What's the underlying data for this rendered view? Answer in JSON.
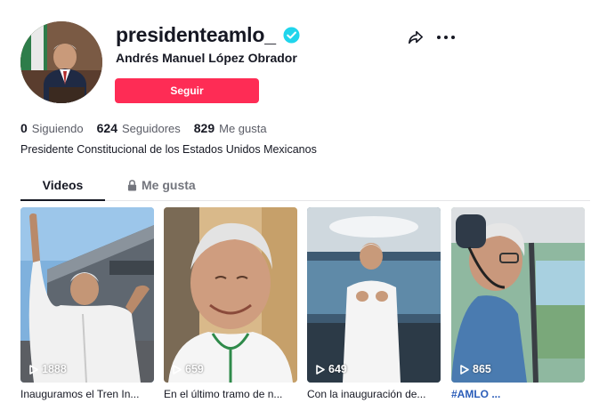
{
  "profile": {
    "username": "presidenteamlo_",
    "display_name": "Andrés Manuel López Obrador",
    "follow_label": "Seguir",
    "bio": "Presidente Constitucional de los Estados Unidos Mexicanos",
    "verified": true
  },
  "stats": {
    "following_count": "0",
    "following_label": "Siguiendo",
    "followers_count": "624",
    "followers_label": "Seguidores",
    "likes_count": "829",
    "likes_label": "Me gusta"
  },
  "tabs": [
    {
      "label": "Videos",
      "active": true
    },
    {
      "label": "Me gusta",
      "active": false,
      "icon": "lock-icon"
    }
  ],
  "videos": [
    {
      "views": "1888",
      "caption": "Inauguramos el Tren In..."
    },
    {
      "views": "659",
      "caption": "En el último tramo de n..."
    },
    {
      "views": "649",
      "caption": "Con la inauguración de..."
    },
    {
      "views": "865",
      "caption": "#AMLO ..."
    }
  ],
  "colors": {
    "accent": "#fe2c55",
    "verified": "#20d5ec",
    "hashtag": "#2b5db9"
  }
}
